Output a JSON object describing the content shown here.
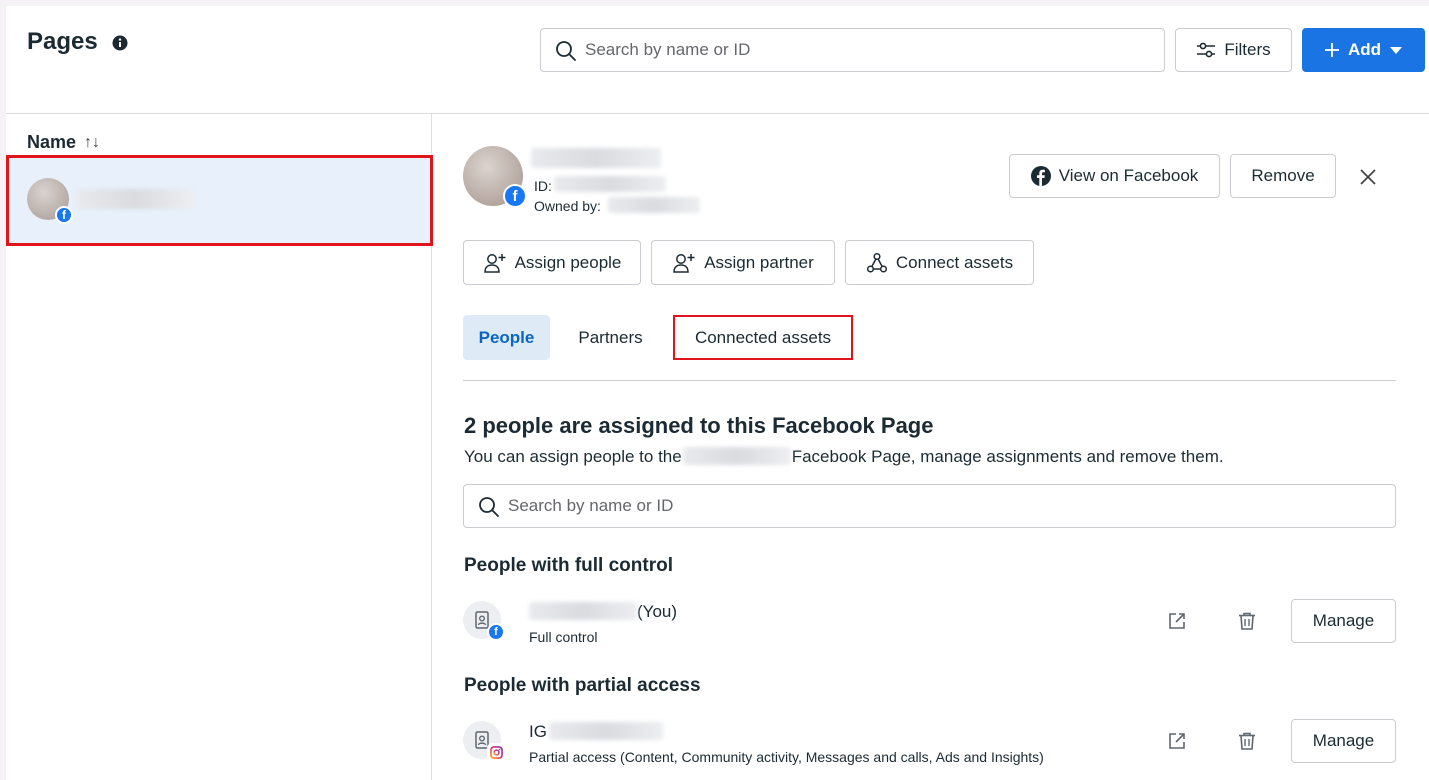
{
  "header": {
    "title": "Pages",
    "search_placeholder": "Search by name or ID",
    "filters_label": "Filters",
    "add_label": "Add"
  },
  "list": {
    "column_header": "Name",
    "sort_glyph": "↑↓"
  },
  "detail": {
    "id_label": "ID:",
    "owned_by_label": "Owned by:",
    "view_on_facebook_label": "View on Facebook",
    "remove_label": "Remove",
    "actions": {
      "assign_people": "Assign people",
      "assign_partner": "Assign partner",
      "connect_assets": "Connect assets"
    },
    "tabs": {
      "people": "People",
      "partners": "Partners",
      "connected_assets": "Connected assets"
    },
    "people_section": {
      "title": "2 people are assigned to this Facebook Page",
      "desc_prefix": "You can assign people to the",
      "desc_suffix": "Facebook Page, manage assignments and remove them.",
      "search_placeholder": "Search by name or ID",
      "full_control_title": "People with full control",
      "partial_access_title": "People with partial access",
      "full_person": {
        "name_suffix": "(You)",
        "role": "Full control",
        "manage_label": "Manage"
      },
      "partial_person": {
        "name_prefix": "IG",
        "role": "Partial access (Content, Community activity, Messages and calls, Ads and Insights)",
        "manage_label": "Manage"
      }
    }
  },
  "colors": {
    "brand_blue": "#1b74e4",
    "highlight_red": "#e0151c",
    "selected_row": "#e7f0fb",
    "active_tab_bg": "#deebf7"
  }
}
